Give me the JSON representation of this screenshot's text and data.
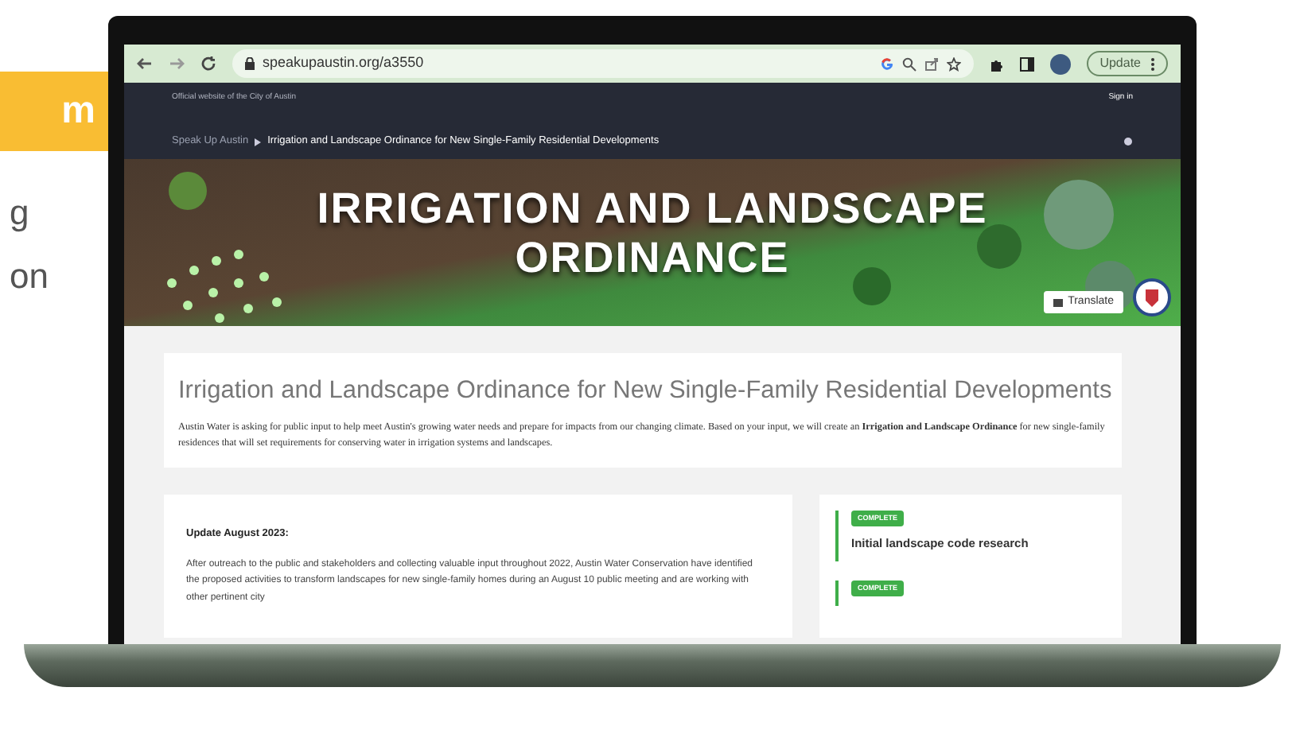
{
  "side_fragments": {
    "badge": "m",
    "lines": [
      "g",
      "on"
    ]
  },
  "browser": {
    "url": "speakupaustin.org/a3550",
    "update_button": "Update"
  },
  "site_header": {
    "official_note": "Official website of the City of Austin",
    "sign_in": "Sign in",
    "breadcrumb": [
      "Speak Up Austin",
      "Irrigation and Landscape Ordinance for New Single-Family Residential Developments"
    ]
  },
  "hero": {
    "title_lines": [
      "IRRIGATION AND LANDSCAPE",
      "ORDINANCE"
    ],
    "translate_button": "Translate"
  },
  "intro": {
    "heading": "Irrigation and Landscape Ordinance for New Single-Family Residential Developments",
    "text": "Austin Water is asking for public input to help meet Austin's growing water needs and prepare for impacts from our changing climate. Based on your input, we will create an **Irrigation and Landscape Ordinance** for new single-family residences that will set requirements for conserving water in irrigation systems and landscapes."
  },
  "update": {
    "title": "Update August 2023:",
    "text": "After outreach to the public and stakeholders and collecting valuable input throughout 2022, Austin Water Conservation have identified the proposed activities to transform landscapes for new single-family homes during an August 10 public meeting and are working with other pertinent city"
  },
  "timeline": [
    {
      "status": "COMPLETE",
      "color": "#3fae49",
      "title": "Initial landscape code research"
    },
    {
      "status": "COMPLETE",
      "color": "#3fae49"
    }
  ]
}
